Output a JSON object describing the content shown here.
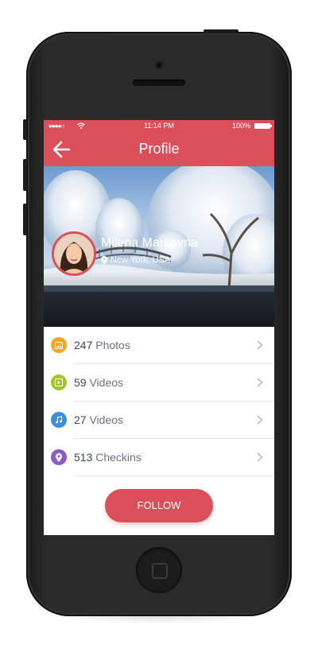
{
  "status_bar": {
    "signal": "●●●●○",
    "time": "11:14 PM",
    "battery": "100%"
  },
  "navbar": {
    "title": "Profile",
    "back_icon": "arrow-left-icon"
  },
  "profile": {
    "name": "Milena Markovna",
    "location": "New York, USA"
  },
  "stats": [
    {
      "count": "247",
      "label": " Photos",
      "icon": "image-icon",
      "color": "#f5a623"
    },
    {
      "count": "59",
      "label": " Videos",
      "icon": "video-icon",
      "color": "#a3c42b"
    },
    {
      "count": "27",
      "label": " Videos",
      "icon": "music-note-icon",
      "color": "#3b8ddd"
    },
    {
      "count": "513",
      "label": " Checkins",
      "icon": "location-pin-icon",
      "color": "#8e5cc9"
    }
  ],
  "follow_button": {
    "label": "FOLLOW"
  },
  "colors": {
    "accent": "#db4f5a",
    "text_dark": "#3e4562",
    "text_light": "#6b7189"
  }
}
